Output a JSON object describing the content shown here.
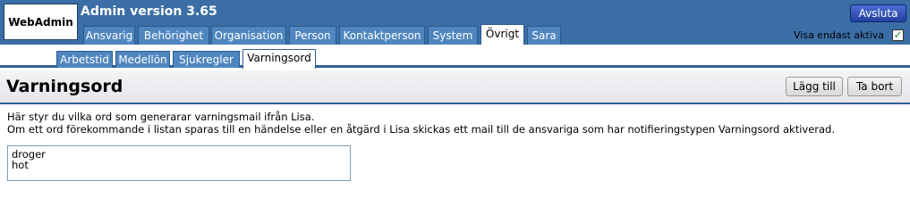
{
  "app": {
    "logo": "WebAdmin",
    "title": "Admin version 3.65"
  },
  "header": {
    "logout_label": "Avsluta",
    "active_only_label": "Visa endast aktiva",
    "active_only_checked": true
  },
  "tabs": [
    "Ansvarig",
    "Behörighet",
    "Organisation",
    "Person",
    "Kontaktperson",
    "System",
    "Övrigt",
    "Sara"
  ],
  "active_tab": "Övrigt",
  "subtabs": [
    "Arbetstid",
    "Medellön",
    "Sjukregler",
    "Varningsord"
  ],
  "active_subtab": "Varningsord",
  "page": {
    "title": "Varningsord",
    "add_label": "Lägg till",
    "remove_label": "Ta bort",
    "description_lines": [
      "Här styr du vilka ord som generarar varningsmail ifrån Lisa.",
      "Om ett ord förekommande i listan sparas till en händelse eller en åtgärd i Lisa skickas ett mail till de ansvariga som har notifieringstypen Varningsord aktiverad."
    ],
    "words": [
      "droger",
      "hot"
    ]
  },
  "colors": {
    "header_bg": "#3b6ea5",
    "tab_bg": "#4f86bf",
    "accent_border": "#2f5f97"
  }
}
